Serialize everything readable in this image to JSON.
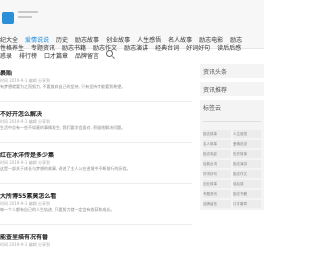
{
  "nav": {
    "row1": [
      "纪大全",
      "爱情说说",
      "历史",
      "励志故事",
      "创业故事",
      "人生感悟",
      "名人故事",
      "励志电影",
      "励志"
    ],
    "row2": [
      "性格养生",
      "专题资讯",
      "励志书籍",
      "励志作文",
      "励志演讲",
      "经典台词",
      "好词好句",
      "读后后感"
    ],
    "row3": [
      "惑录",
      "排行榜",
      "口才篇章",
      "品牌留言"
    ],
    "active_index_row1": 1
  },
  "main": {
    "articles": [
      {
        "title": "裹贻",
        "meta": "时间  2019-9-1   编辑  分享到",
        "summary": "有梦想就要为之而努力, 不要放弃自己的坚持, 只有坚持才能看到希望。"
      },
      {
        "title": "不好开怎么解决",
        "meta": "时间  2019-9-1   编辑  分享到",
        "summary": "生活中总有一些不如意的事情发生, 我们要学会面对, 积极地解决问题。"
      },
      {
        "title": "红在冰洋传是多少集",
        "meta": "时间  2019-9-1   编辑  分享到",
        "summary": "这是一部关于成长与梦想的故事, 讲述了主人公在逆境中不断前行的历程。"
      },
      {
        "title": "大所博55素莫怎么看",
        "meta": "时间  2019-9-1   编辑  分享到",
        "summary": "每一个人都有自己的人生轨迹, 只要努力就一定会有收获和成长。"
      },
      {
        "title": "能查里描有况有番",
        "meta": "时间  2019-9-1   编辑  分享到",
        "summary": ""
      }
    ]
  },
  "sidebar": {
    "box1": "资讯头条",
    "box2": "资讯推荐",
    "box3": "标签云",
    "tags": [
      "励志故事",
      "人生感悟",
      "名人故事",
      "爱情说说",
      "励志电影",
      "历史故事",
      "经典台词",
      "励志演讲",
      "好词好句",
      "励志作文",
      "创业故事",
      "读后感",
      "专题资讯",
      "励志书籍",
      "品牌留言",
      "口才篇章"
    ]
  }
}
